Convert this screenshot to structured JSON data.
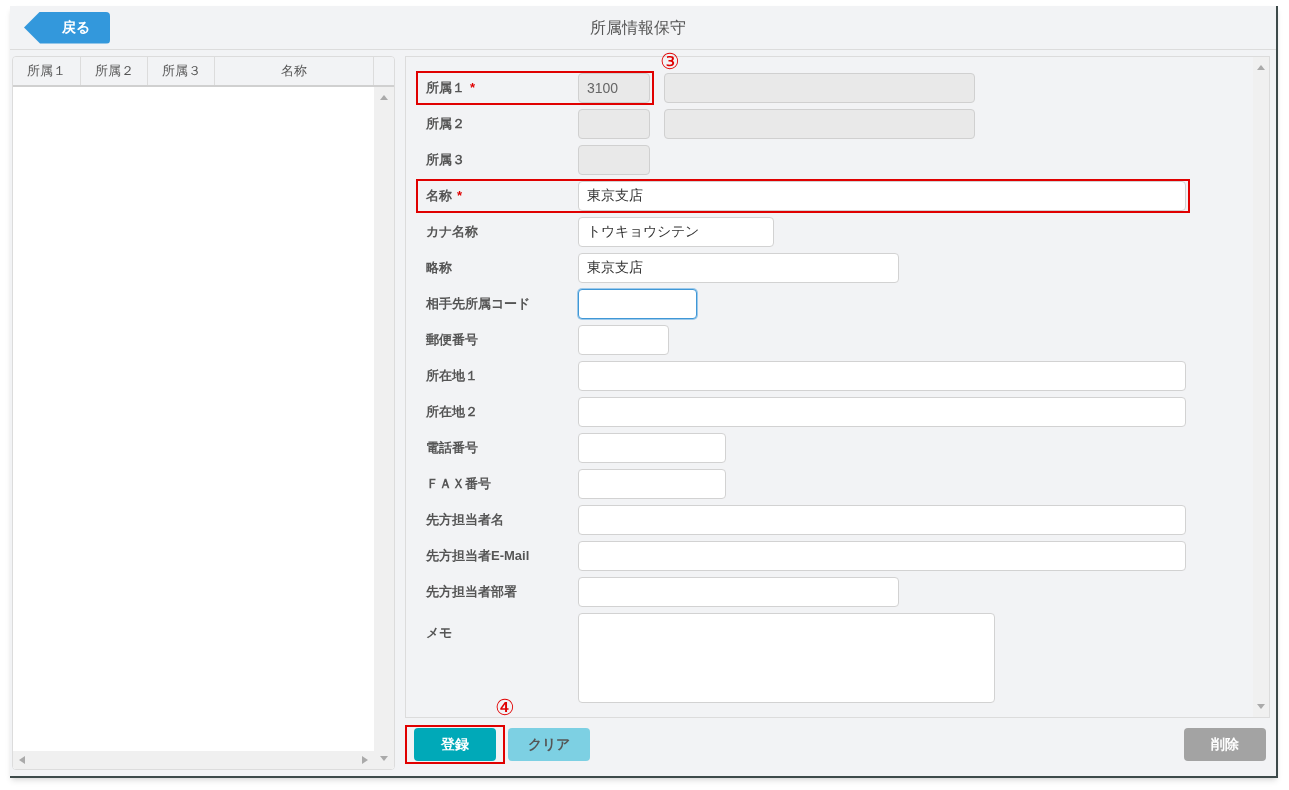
{
  "header": {
    "back_button": "戻る",
    "title": "所属情報保守"
  },
  "list": {
    "columns": [
      "所属１",
      "所属２",
      "所属３",
      "名称"
    ]
  },
  "form": {
    "fields": [
      {
        "label": "所属１",
        "required_mark": "*",
        "value": "3100",
        "kind": "input",
        "disabled": true,
        "focused": false,
        "highlighted": true,
        "annotation": "③",
        "secondary": {
          "disabled": true
        }
      },
      {
        "label": "所属２",
        "kind": "input",
        "disabled": true,
        "focused": false,
        "highlighted": false,
        "secondary": {
          "disabled": true
        }
      },
      {
        "label": "所属３",
        "kind": "input",
        "disabled": true,
        "focused": false,
        "highlighted": false
      },
      {
        "label": "名称",
        "required_mark": "*",
        "value": "東京支店",
        "kind": "input",
        "disabled": false,
        "focused": false,
        "highlighted": true
      },
      {
        "label": "カナ名称",
        "value": "トウキョウシテン",
        "kind": "input",
        "disabled": false,
        "focused": false,
        "highlighted": false
      },
      {
        "label": "略称",
        "value": "東京支店",
        "kind": "input",
        "disabled": false,
        "focused": false,
        "highlighted": false
      },
      {
        "label": "相手先所属コード",
        "kind": "input",
        "disabled": false,
        "focused": true,
        "highlighted": false
      },
      {
        "label": "郵便番号",
        "kind": "input",
        "disabled": false,
        "focused": false,
        "highlighted": false
      },
      {
        "label": "所在地１",
        "kind": "input",
        "disabled": false,
        "focused": false,
        "highlighted": false
      },
      {
        "label": "所在地２",
        "kind": "input",
        "disabled": false,
        "focused": false,
        "highlighted": false
      },
      {
        "label": "電話番号",
        "kind": "input",
        "disabled": false,
        "focused": false,
        "highlighted": false
      },
      {
        "label": "ＦＡＸ番号",
        "kind": "input",
        "disabled": false,
        "focused": false,
        "highlighted": false
      },
      {
        "label": "先方担当者名",
        "kind": "input",
        "disabled": false,
        "focused": false,
        "highlighted": false
      },
      {
        "label": "先方担当者E-Mail",
        "kind": "input",
        "disabled": false,
        "focused": false,
        "highlighted": false
      },
      {
        "label": "先方担当者部署",
        "kind": "input",
        "disabled": false,
        "focused": false,
        "highlighted": false
      },
      {
        "label": "メモ",
        "kind": "textarea",
        "disabled": false,
        "focused": false,
        "highlighted": false
      }
    ]
  },
  "footer": {
    "buttons": [
      {
        "label": "登録",
        "kind": "primary",
        "highlighted": true,
        "annotation": "④"
      },
      {
        "label": "クリア",
        "kind": "secondary",
        "highlighted": false
      },
      {
        "label": "削除",
        "kind": "danger",
        "highlighted": false
      }
    ]
  }
}
